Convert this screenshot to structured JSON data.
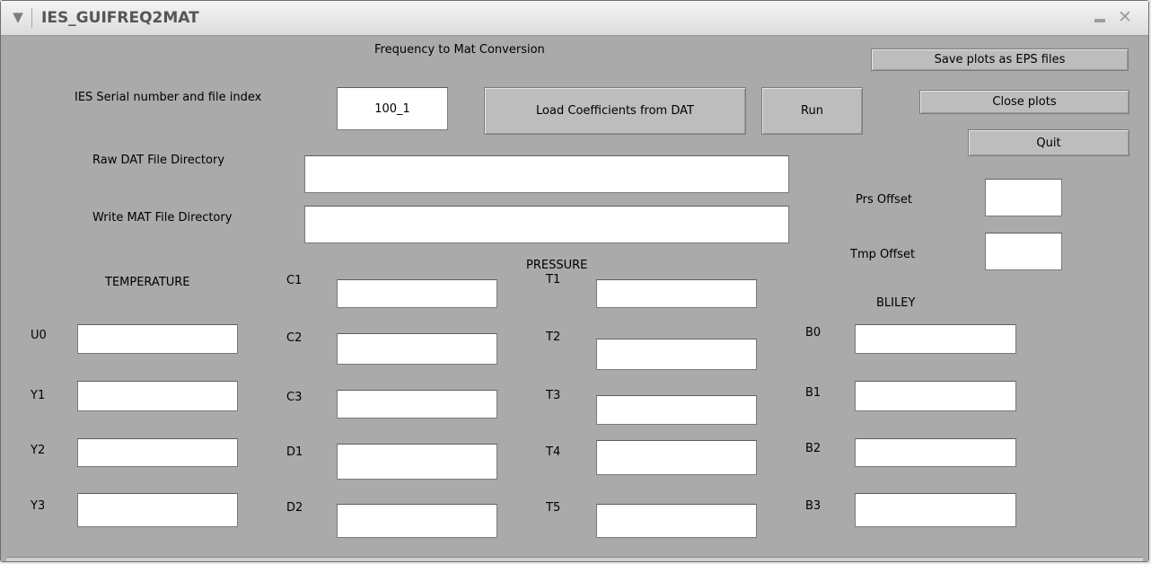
{
  "window": {
    "title": "IES_GUIFREQ2MAT",
    "menu_glyph": "▼",
    "close_glyph": "✕"
  },
  "heading": "Frequency to Mat Conversion",
  "serial": {
    "label": "IES Serial number and file index",
    "value": "100_1"
  },
  "buttons": {
    "load": "Load Coefficients from DAT",
    "run": "Run",
    "save_eps": "Save plots as EPS files",
    "close_plots": "Close plots",
    "quit": "Quit"
  },
  "dirs": {
    "raw_label": "Raw DAT File Directory",
    "raw_value": "",
    "write_label": "Write MAT File Directory",
    "write_value": ""
  },
  "offsets": {
    "prs_label": "Prs Offset",
    "prs_value": "",
    "tmp_label": "Tmp Offset",
    "tmp_value": ""
  },
  "sections": {
    "temperature": "TEMPERATURE",
    "pressure": "PRESSURE",
    "bliley": "BLILEY"
  },
  "temperature": {
    "u0": "U0",
    "y1": "Y1",
    "y2": "Y2",
    "y3": "Y3",
    "c1": "C1",
    "c2": "C2",
    "c3": "C3",
    "d1": "D1",
    "d2": "D2"
  },
  "pressure": {
    "t1": "T1",
    "t2": "T2",
    "t3": "T3",
    "t4": "T4",
    "t5": "T5"
  },
  "bliley": {
    "b0": "B0",
    "b1": "B1",
    "b2": "B2",
    "b3": "B3"
  },
  "colors": {
    "panel": "#aaaaaa",
    "button": "#bdbdbd",
    "titlebar": "#e4e4e4"
  }
}
